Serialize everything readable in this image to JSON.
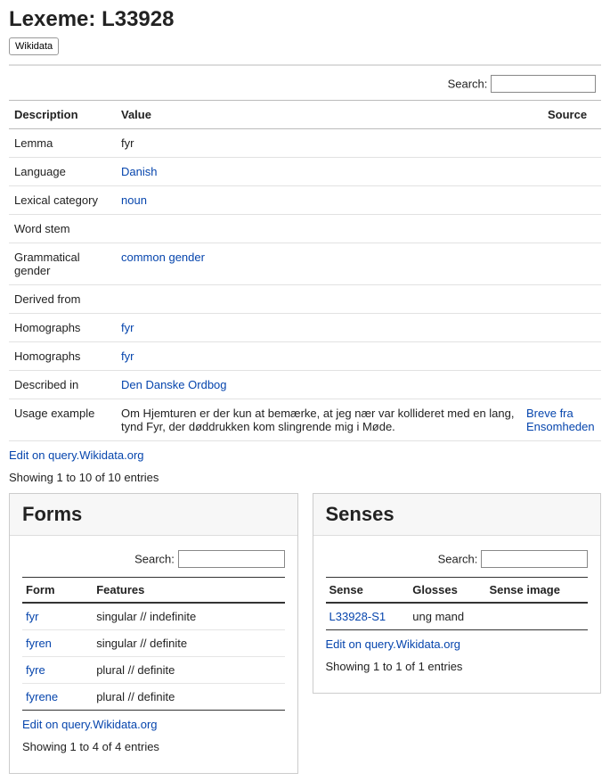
{
  "title_prefix": "Lexeme: ",
  "title_id": "L33928",
  "wikidata_button": "Wikidata",
  "search_label": "Search:",
  "main_headers": {
    "desc": "Description",
    "value": "Value",
    "source": "Source"
  },
  "rows": [
    {
      "desc": "Lemma",
      "value": "fyr",
      "link": false,
      "source": ""
    },
    {
      "desc": "Language",
      "value": "Danish",
      "link": true,
      "source": ""
    },
    {
      "desc": "Lexical category",
      "value": "noun",
      "link": true,
      "source": ""
    },
    {
      "desc": "Word stem",
      "value": "",
      "link": false,
      "source": ""
    },
    {
      "desc": "Grammatical gender",
      "value": "common gender",
      "link": true,
      "source": ""
    },
    {
      "desc": "Derived from",
      "value": "",
      "link": false,
      "source": ""
    },
    {
      "desc": "Homographs",
      "value": "fyr",
      "link": true,
      "source": ""
    },
    {
      "desc": "Homographs",
      "value": "fyr",
      "link": true,
      "source": ""
    },
    {
      "desc": "Described in",
      "value": "Den Danske Ordbog",
      "link": true,
      "source": ""
    },
    {
      "desc": "Usage example",
      "value": "Om Hjemturen er der kun at bemærke, at jeg nær var kollideret med en lang, tynd Fyr, der døddrukken kom slingrende mig i Møde.",
      "link": false,
      "source": "Breve fra Ensomheden",
      "source_link": true
    }
  ],
  "edit_link": "Edit on query.Wikidata.org",
  "main_info": "Showing 1 to 10 of 10 entries",
  "forms": {
    "heading": "Forms",
    "headers": {
      "form": "Form",
      "features": "Features"
    },
    "rows": [
      {
        "form": "fyr",
        "features": "singular // indefinite"
      },
      {
        "form": "fyren",
        "features": "singular // definite"
      },
      {
        "form": "fyre",
        "features": "plural // definite"
      },
      {
        "form": "fyrene",
        "features": "plural // definite"
      }
    ],
    "edit_link": "Edit on query.Wikidata.org",
    "info": "Showing 1 to 4 of 4 entries"
  },
  "senses": {
    "heading": "Senses",
    "headers": {
      "sense": "Sense",
      "glosses": "Glosses",
      "image": "Sense image"
    },
    "rows": [
      {
        "sense": "L33928-S1",
        "glosses": "ung mand",
        "image": ""
      }
    ],
    "edit_link": "Edit on query.Wikidata.org",
    "info": "Showing 1 to 1 of 1 entries"
  }
}
